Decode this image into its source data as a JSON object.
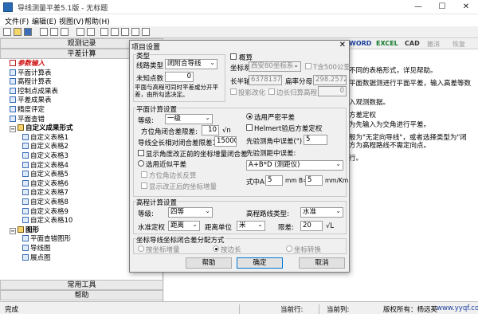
{
  "window": {
    "title": "导线测量平差5.1版 - 无标题",
    "min": "—",
    "max": "☐",
    "close": "✕"
  },
  "menu": [
    "文件(F)",
    "编辑(E)",
    "视图(V)",
    "帮助(H)"
  ],
  "left": {
    "tab_record": "观测记录",
    "tab_adjust": "平差计算",
    "tree": [
      {
        "label": "参数输入",
        "style": "red",
        "icon": "check"
      },
      {
        "label": "平面计算表",
        "icon": "page"
      },
      {
        "label": "高程计算表",
        "icon": "page"
      },
      {
        "label": "控制点成果表",
        "icon": "page"
      },
      {
        "label": "平差成果表",
        "icon": "page"
      },
      {
        "label": "精度评定",
        "icon": "page"
      },
      {
        "label": "平面查错",
        "icon": "page"
      },
      {
        "label": "自定义成果形式",
        "style": "bold",
        "icon": "folder",
        "expander": "−"
      },
      {
        "label": "自定义表格1",
        "icon": "page",
        "indent": 1
      },
      {
        "label": "自定义表格2",
        "icon": "page",
        "indent": 1
      },
      {
        "label": "自定义表格3",
        "icon": "page",
        "indent": 1
      },
      {
        "label": "自定义表格4",
        "icon": "page",
        "indent": 1
      },
      {
        "label": "自定义表格5",
        "icon": "page",
        "indent": 1
      },
      {
        "label": "自定义表格6",
        "icon": "page",
        "indent": 1
      },
      {
        "label": "自定义表格7",
        "icon": "page",
        "indent": 1
      },
      {
        "label": "自定义表格8",
        "icon": "page",
        "indent": 1
      },
      {
        "label": "自定义表格9",
        "icon": "page",
        "indent": 1
      },
      {
        "label": "自定义表格10",
        "icon": "page",
        "indent": 1
      },
      {
        "label": "图形",
        "style": "bold",
        "icon": "folder",
        "expander": "−"
      },
      {
        "label": "平面查错图形",
        "icon": "page",
        "indent": 1
      },
      {
        "label": "导线图",
        "icon": "page",
        "indent": 1
      },
      {
        "label": "展点图",
        "icon": "page",
        "indent": 1
      }
    ],
    "tab_tools": "常用工具",
    "tab_help": "帮助"
  },
  "doc_toolbar": {
    "word": "WORD",
    "excel": "EXCEL",
    "cad": "CAD",
    "undo": "撤消",
    "redo": "恢复"
  },
  "doc_lines": [
    "不同的表格形式，详见帮助。",
    "平面数据测进行平面平差，输入高差等数",
    "入观测数据。",
    "方差定权",
    "为先输入为交角进行平差。",
    "般为\"无定向导线\"，或者选择类型为\"闭",
    "方为高程路线不需定向点。",
    "行。"
  ],
  "status": {
    "left": "完成",
    "row": "当前行:",
    "col": "当前列:",
    "copyright": "版权所有：杨远英",
    "site": "www.yyqf.com"
  },
  "dialog": {
    "title": "项目设置",
    "close": "✕",
    "type": {
      "group": "类型",
      "route_type_label": "线路类型",
      "route_type": "闭附合导线",
      "unknown_label": "未知点数",
      "unknown_value": "0",
      "note": "平面与高程可同时平差或分开平差，由所勾选决定。",
      "smooth_label": "概算",
      "coord_label": "坐标系",
      "coord_value": "西安80坐标系",
      "six_deg_label": "T含500公里",
      "central_label": "长半轴",
      "central_value": "6378137",
      "flattening_label": "扁率分母",
      "flattening_value": "298.257222",
      "proj_label": "投影改化",
      "edge_label": "边长归算高程",
      "edge_value": "0"
    },
    "plane": {
      "group": "平面计算设置",
      "grade_label": "等级:",
      "grade_value": "一级",
      "angle_limit_label": "方位角闭合差限差:",
      "angle_limit_value": "10",
      "angle_unit": "√n",
      "rel_limit_label": "导线全长相对闭合差限差1/",
      "rel_limit_value": "15000",
      "show_corr_label": "显示角度改正前的坐标增量闭合差",
      "approx_label": "选用近似平差",
      "azimuth_label": "方位角边长反算",
      "show_inc_label": "显示改正后的坐标增量",
      "strict_label": "选用严密平差",
      "helmert_label": "Helmert验后方差定权",
      "dir_err_label": "先验测角中误差(\")",
      "dir_err_value": "5",
      "dist_err_label": "先验测距中误差:",
      "formula_value": "A+B*D  (测距仪)",
      "a_label": "式中A=",
      "a_value": "5",
      "a_unit": "mm B=",
      "b_value": "5",
      "b_unit": "mm/Km"
    },
    "height": {
      "group": "高程计算设置",
      "grade_label": "等级:",
      "grade_value": "四等",
      "route_label": "高程路线类型:",
      "route_value": "水准",
      "weight_label": "水准定权",
      "weight_value": "距离",
      "unit_label": "距离单位",
      "unit_value": "米",
      "limit_label": "限差:",
      "limit_value": "20",
      "limit_unit": "√L"
    },
    "dist": {
      "group": "坐标导线坐标闭合差分配方式",
      "opt1": "按坐标增量",
      "opt2": "按边长",
      "opt3": "坐标转换"
    },
    "buttons": {
      "help": "帮助",
      "ok": "确定",
      "cancel": "取消"
    }
  }
}
